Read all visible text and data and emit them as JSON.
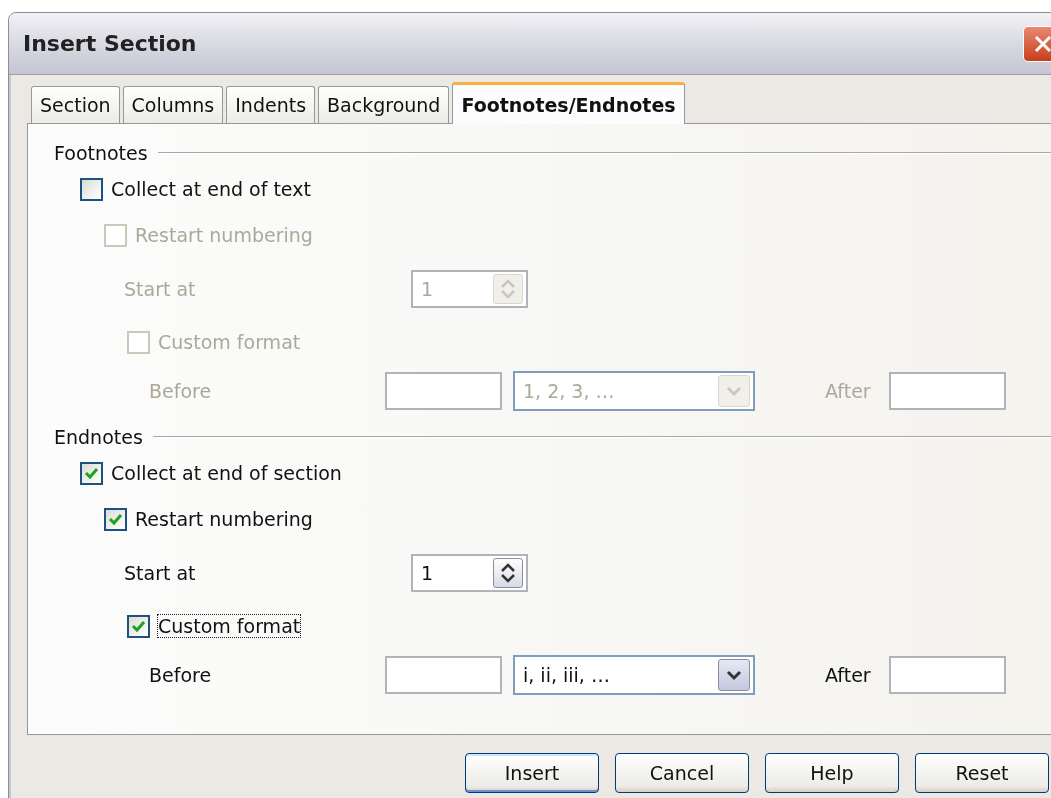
{
  "window": {
    "title": "Insert Section"
  },
  "tabs": [
    {
      "label": "Section",
      "selected": false
    },
    {
      "label": "Columns",
      "selected": false
    },
    {
      "label": "Indents",
      "selected": false
    },
    {
      "label": "Background",
      "selected": false
    },
    {
      "label": "Footnotes/Endnotes",
      "selected": true
    }
  ],
  "groups": [
    {
      "title": "Footnotes",
      "collect": {
        "label": "Collect at end of text",
        "checked": false,
        "disabled": false
      },
      "restart": {
        "label": "Restart numbering",
        "checked": false,
        "disabled": true
      },
      "start_at": {
        "label": "Start at",
        "value": "1",
        "disabled": true
      },
      "custom_format": {
        "label": "Custom format",
        "checked": false,
        "disabled": true,
        "focused": false
      },
      "before": {
        "label": "Before",
        "disabled": true
      },
      "format": {
        "value": "1, 2, 3, …",
        "disabled": true
      },
      "after": {
        "label": "After",
        "disabled": true
      }
    },
    {
      "title": "Endnotes",
      "collect": {
        "label": "Collect at end of section",
        "checked": true,
        "disabled": false
      },
      "restart": {
        "label": "Restart numbering",
        "checked": true,
        "disabled": false
      },
      "start_at": {
        "label": "Start at",
        "value": "1",
        "disabled": false
      },
      "custom_format": {
        "label": "Custom format",
        "checked": true,
        "disabled": false,
        "focused": true
      },
      "before": {
        "label": "Before",
        "disabled": false
      },
      "format": {
        "value": "i, ii, iii, …",
        "disabled": false
      },
      "after": {
        "label": "After",
        "disabled": false
      }
    }
  ],
  "buttons": [
    {
      "label": "Insert",
      "default": true
    },
    {
      "label": "Cancel",
      "default": false
    },
    {
      "label": "Help",
      "default": false
    },
    {
      "label": "Reset",
      "default": false
    }
  ]
}
